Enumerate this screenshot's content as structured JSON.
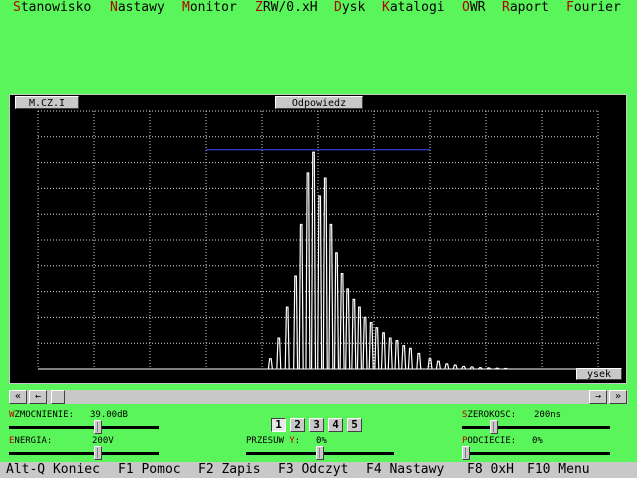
{
  "menu": {
    "items": [
      {
        "hotkey": "S",
        "rest": "tanowisko"
      },
      {
        "hotkey": "N",
        "rest": "astawy"
      },
      {
        "hotkey": "M",
        "rest": "onitor"
      },
      {
        "hotkey": "Z",
        "rest": "RW/0.xH"
      },
      {
        "hotkey": "D",
        "rest": "ysk"
      },
      {
        "hotkey": "K",
        "rest": "atalogi"
      },
      {
        "hotkey": "O",
        "rest": "WR"
      },
      {
        "hotkey": "R",
        "rest": "aport"
      },
      {
        "hotkey": "F",
        "rest": "ourier"
      }
    ]
  },
  "scope": {
    "left_tab": "M.CZ.I",
    "title_tab": "Odpowiedz",
    "corner_btn": "ysek"
  },
  "scroll": {
    "left_fast": "«",
    "left": "←",
    "right": "→",
    "right_fast": "»",
    "position": 0.0
  },
  "controls": {
    "gain": {
      "hotkey": "W",
      "rest": "ZMOCNIENIE:",
      "value": "39.00dB",
      "level": 0.6
    },
    "energy": {
      "hotkey": "E",
      "rest": "NERGIA:",
      "value": "200V",
      "level": 0.6
    },
    "shift": {
      "label_a": "PRZESUW ",
      "hotkey": "Y",
      "label_b": ":",
      "value": "0%",
      "level": 0.5
    },
    "width": {
      "hotkey": "S",
      "rest": "ZEROKOSC:",
      "value": "200ns",
      "level": 0.2
    },
    "cut": {
      "hotkey": "P",
      "rest": "ODCIECIE:",
      "value": "0%",
      "level": 0.0
    },
    "channels": [
      "1",
      "2",
      "3",
      "4",
      "5"
    ],
    "active_channel": "1"
  },
  "status": {
    "keys": [
      "Alt-Q Koniec",
      "F1 Pomoc",
      "F2 Zapis",
      "F3 Odczyt",
      "F4 Nastawy",
      "F8 0xH",
      "F10 Menu"
    ]
  },
  "colors": {
    "background": "#5af55a",
    "hotkey": "#b00000",
    "trace": "#ffffff",
    "gate": "#3a4cff"
  },
  "chart_data": {
    "type": "line",
    "title": "",
    "xlabel": "",
    "ylabel": "",
    "grid": true,
    "xlim": [
      0,
      10
    ],
    "ylim": [
      0,
      10
    ],
    "gate": {
      "x": [
        3,
        7
      ],
      "y": 8.5
    },
    "peaks": [
      {
        "x": 4.15,
        "y": 0.4
      },
      {
        "x": 4.3,
        "y": 1.2
      },
      {
        "x": 4.45,
        "y": 2.4
      },
      {
        "x": 4.6,
        "y": 3.6
      },
      {
        "x": 4.7,
        "y": 5.6
      },
      {
        "x": 4.82,
        "y": 7.6
      },
      {
        "x": 4.92,
        "y": 8.4
      },
      {
        "x": 5.03,
        "y": 6.7
      },
      {
        "x": 5.13,
        "y": 7.4
      },
      {
        "x": 5.23,
        "y": 5.6
      },
      {
        "x": 5.33,
        "y": 4.5
      },
      {
        "x": 5.43,
        "y": 3.7
      },
      {
        "x": 5.53,
        "y": 3.1
      },
      {
        "x": 5.64,
        "y": 2.7
      },
      {
        "x": 5.74,
        "y": 2.4
      },
      {
        "x": 5.84,
        "y": 2.0
      },
      {
        "x": 5.95,
        "y": 1.8
      },
      {
        "x": 6.05,
        "y": 1.6
      },
      {
        "x": 6.17,
        "y": 1.4
      },
      {
        "x": 6.29,
        "y": 1.2
      },
      {
        "x": 6.41,
        "y": 1.1
      },
      {
        "x": 6.53,
        "y": 0.9
      },
      {
        "x": 6.65,
        "y": 0.8
      },
      {
        "x": 6.8,
        "y": 0.6
      },
      {
        "x": 7.0,
        "y": 0.4
      },
      {
        "x": 7.15,
        "y": 0.3
      },
      {
        "x": 7.3,
        "y": 0.2
      },
      {
        "x": 7.45,
        "y": 0.15
      },
      {
        "x": 7.6,
        "y": 0.1
      },
      {
        "x": 7.75,
        "y": 0.08
      },
      {
        "x": 7.9,
        "y": 0.05
      },
      {
        "x": 8.05,
        "y": 0.04
      },
      {
        "x": 8.2,
        "y": 0.03
      },
      {
        "x": 8.35,
        "y": 0.02
      }
    ]
  }
}
